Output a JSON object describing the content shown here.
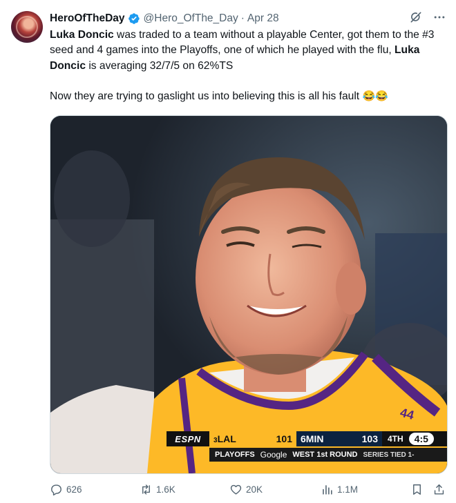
{
  "author": {
    "name": "HeroOfTheDay",
    "handle": "@Hero_OfThe_Day",
    "separator": "·",
    "date": "Apr 28",
    "verified": true
  },
  "tweet": {
    "p1_bold1": "Luka Doncic",
    "p1_text1": " was traded to a team without a playable Center, got them to the #3 seed and 4 games into the Playoffs, one of which he played with the flu, ",
    "p1_bold2": "Luka Doncic",
    "p1_text2": " is averaging 32/7/5 on 62%TS",
    "p2_text": "Now they are trying to gaslight us into believing this is all his fault ",
    "p2_emoji": "😂😂"
  },
  "scoreboard": {
    "network": "ESPN",
    "home_seed": "3",
    "home_team": "LAL",
    "home_score": "101",
    "away_seed": "6",
    "away_team": "MIN",
    "away_score": "103",
    "quarter": "4TH",
    "clock": "4:5",
    "event": "PLAYOFFS",
    "sponsor": "Google",
    "round": "WEST 1st ROUND",
    "series": "SERIES TIED 1-"
  },
  "metrics": {
    "replies": "626",
    "reposts": "1.6K",
    "likes": "20K",
    "views": "1.1M"
  },
  "colors": {
    "accent": "#1d9bf0",
    "muted": "#536471",
    "lakers_gold": "#fdb927",
    "lakers_purple": "#552583"
  }
}
